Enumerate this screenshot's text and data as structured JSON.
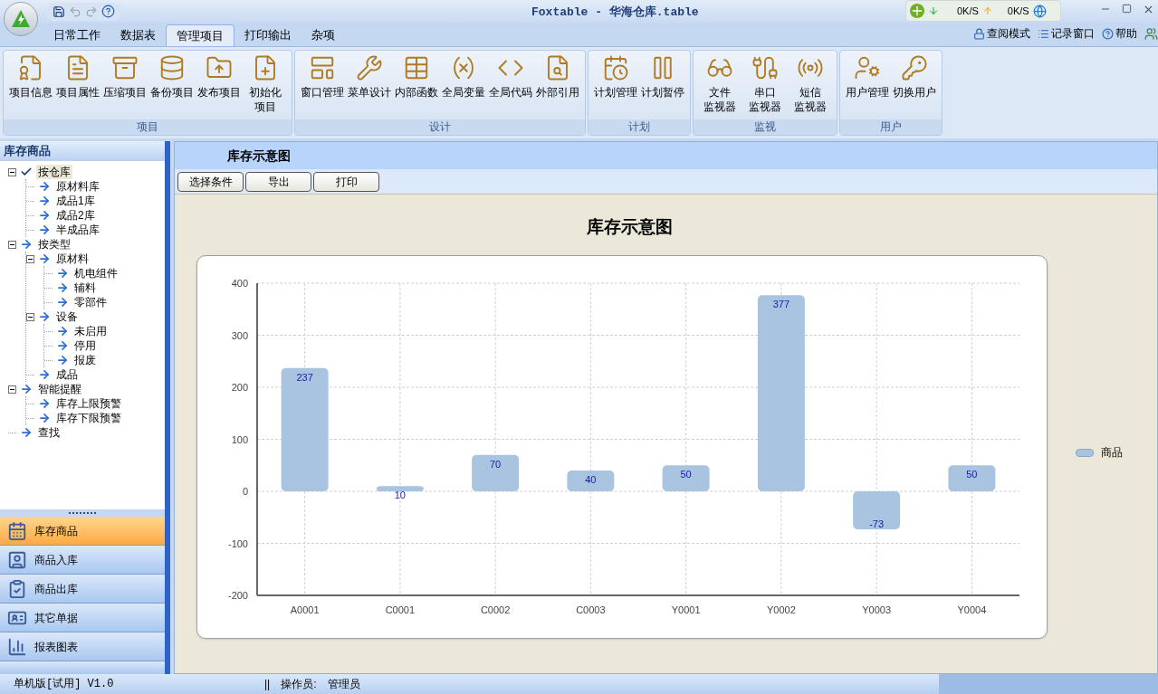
{
  "window": {
    "title": "Foxtable - 华海仓库.table"
  },
  "network_widget": {
    "download": "0K/S",
    "upload": "0K/S"
  },
  "ribbon_tabs": [
    {
      "label": "日常工作",
      "selected": false
    },
    {
      "label": "数据表",
      "selected": false
    },
    {
      "label": "管理项目",
      "selected": true
    },
    {
      "label": "打印输出",
      "selected": false
    },
    {
      "label": "杂项",
      "selected": false
    }
  ],
  "ribbon_links": [
    "查阅模式",
    "记录窗口",
    "帮助"
  ],
  "ribbon_groups": [
    {
      "label": "项目",
      "items": [
        [
          "项目信息"
        ],
        [
          "项目属性"
        ],
        [
          "压缩项目"
        ],
        [
          "备份项目"
        ],
        [
          "发布项目"
        ],
        [
          "初始化",
          "项目"
        ]
      ]
    },
    {
      "label": "设计",
      "items": [
        [
          "窗口管理"
        ],
        [
          "菜单设计"
        ],
        [
          "内部函数"
        ],
        [
          "全局变量"
        ],
        [
          "全局代码"
        ],
        [
          "外部引用"
        ]
      ]
    },
    {
      "label": "计划",
      "items": [
        [
          "计划管理"
        ],
        [
          "计划暂停"
        ]
      ]
    },
    {
      "label": "监视",
      "items": [
        [
          "文件",
          "监视器"
        ],
        [
          "串口",
          "监视器"
        ],
        [
          "短信",
          "监视器"
        ]
      ]
    },
    {
      "label": "用户",
      "items": [
        [
          "用户管理"
        ],
        [
          "切换用户"
        ]
      ]
    }
  ],
  "sidebar": {
    "title": "库存商品",
    "tree": [
      {
        "label": "按仓库",
        "selected": true,
        "expanded": true,
        "children": [
          {
            "label": "原材料库",
            "selected": false
          },
          {
            "label": "成品1库",
            "selected": false
          },
          {
            "label": "成品2库",
            "selected": false
          },
          {
            "label": "半成品库",
            "selected": false
          }
        ]
      },
      {
        "label": "按类型",
        "selected": false,
        "expanded": true,
        "children": [
          {
            "label": "原材料",
            "selected": false,
            "expanded": true,
            "children": [
              {
                "label": "机电组件",
                "selected": false
              },
              {
                "label": "辅料",
                "selected": false
              },
              {
                "label": "零部件",
                "selected": false
              }
            ]
          },
          {
            "label": "设备",
            "selected": false,
            "expanded": true,
            "children": [
              {
                "label": "未启用",
                "selected": false
              },
              {
                "label": "停用",
                "selected": false
              },
              {
                "label": "报废",
                "selected": false
              }
            ]
          },
          {
            "label": "成品",
            "selected": false
          }
        ]
      },
      {
        "label": "智能提醒",
        "selected": false,
        "expanded": true,
        "children": [
          {
            "label": "库存上限预警",
            "selected": false
          },
          {
            "label": "库存下限预警",
            "selected": false
          }
        ]
      },
      {
        "label": "查找",
        "selected": false
      }
    ],
    "nav": [
      {
        "label": "库存商品",
        "selected": true
      },
      {
        "label": "商品入库",
        "selected": false
      },
      {
        "label": "商品出库",
        "selected": false
      },
      {
        "label": "其它单据",
        "selected": false
      },
      {
        "label": "报表图表",
        "selected": false
      }
    ]
  },
  "content": {
    "title": "库存示意图",
    "buttons": [
      "选择条件",
      "导出",
      "打印"
    ],
    "chart_data": {
      "type": "bar",
      "title": "库存示意图",
      "categories": [
        "A0001",
        "C0001",
        "C0002",
        "C0003",
        "Y0001",
        "Y0002",
        "Y0003",
        "Y0004"
      ],
      "series": [
        {
          "name": "商品",
          "color": "#a9c4e0",
          "values": [
            237,
            10,
            70,
            40,
            50,
            377,
            -73,
            50
          ]
        }
      ],
      "grid": true,
      "ylim": [
        -200,
        400
      ],
      "yticks": [
        -200,
        -100,
        0,
        100,
        200,
        300,
        400
      ],
      "data_labels": true
    }
  },
  "status_bar": {
    "version": "单机版[试用] V1.0",
    "separator": "||",
    "operator_label": "操作员:",
    "operator": "管理员"
  }
}
